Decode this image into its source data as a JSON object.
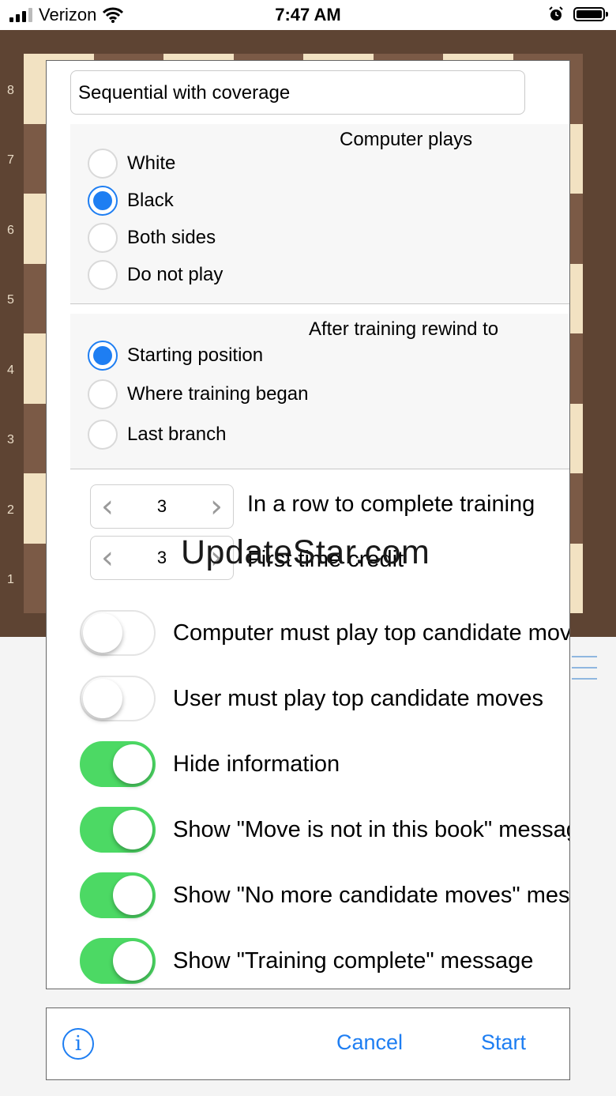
{
  "status_bar": {
    "carrier": "Verizon",
    "time": "7:47 AM"
  },
  "board": {
    "rank_labels": [
      "8",
      "7",
      "6",
      "5",
      "4",
      "3",
      "2",
      "1"
    ]
  },
  "dialog": {
    "mode_select": "Sequential with coverage",
    "computer_plays": {
      "title": "Computer plays",
      "options": [
        "White",
        "Black",
        "Both sides",
        "Do not play"
      ],
      "selected": "Black"
    },
    "rewind": {
      "title": "After training rewind to",
      "options": [
        "Starting position",
        "Where training began",
        "Last branch"
      ],
      "selected": "Starting position"
    },
    "steppers": [
      {
        "value": "3",
        "label": "In a row to complete training"
      },
      {
        "value": "3",
        "label": "First time credit"
      }
    ],
    "toggles": [
      {
        "label": "Computer must play top candidate moves",
        "on": false
      },
      {
        "label": "User must play top candidate moves",
        "on": false
      },
      {
        "label": "Hide information",
        "on": true
      },
      {
        "label": "Show \"Move is not in this book\" message",
        "on": true
      },
      {
        "label": "Show \"No more candidate moves\" message",
        "on": true
      },
      {
        "label": "Show \"Training complete\" message",
        "on": true
      }
    ],
    "watermark": "UpdateStar.com"
  },
  "bottom_bar": {
    "cancel": "Cancel",
    "start": "Start"
  },
  "colors": {
    "accent": "#1e7ef2",
    "toggle_on": "#4cd964"
  }
}
